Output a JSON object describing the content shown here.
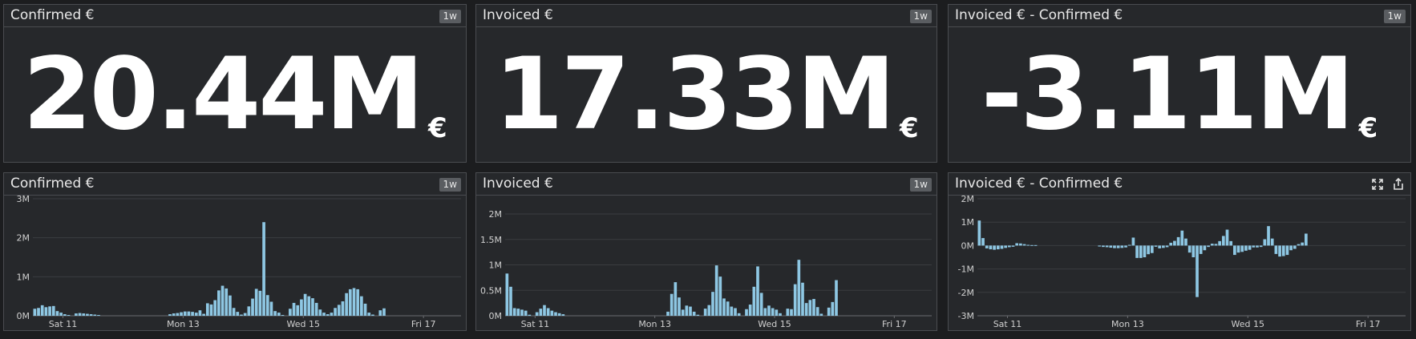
{
  "theme": {
    "bar_color": "#8ec7e3",
    "grid_color": "#3a3c40",
    "panel_bg": "#26282b"
  },
  "query_values": [
    {
      "title": "Confirmed €",
      "badge": "1w",
      "value": "20.44M",
      "unit": "€"
    },
    {
      "title": "Invoiced €",
      "badge": "1w",
      "value": "17.33M",
      "unit": "€"
    },
    {
      "title": "Invoiced € - Confirmed €",
      "badge": "1w",
      "value": "-3.11M",
      "unit": "€"
    }
  ],
  "timeseries": [
    {
      "title": "Confirmed €",
      "badge": "1w"
    },
    {
      "title": "Invoiced €",
      "badge": "1w"
    },
    {
      "title": "Invoiced € - Confirmed €",
      "icons": [
        "expand-icon",
        "export-icon"
      ]
    }
  ],
  "chart_data": [
    {
      "type": "bar",
      "title": "Confirmed €",
      "x_ticks": [
        "Sat 11",
        "Mon 13",
        "Wed 15",
        "Fri 17"
      ],
      "x_tick_index": [
        8,
        40,
        72,
        104
      ],
      "y_ticks": [
        "0M",
        "1M",
        "2M",
        "3M"
      ],
      "y_tick_values": [
        0,
        1,
        2,
        3
      ],
      "ylim": [
        0,
        3
      ],
      "unit": "M€",
      "values": [
        0.18,
        0.2,
        0.27,
        0.22,
        0.24,
        0.25,
        0.12,
        0.08,
        0.04,
        0.02,
        0.0,
        0.06,
        0.07,
        0.06,
        0.05,
        0.04,
        0.03,
        0.02,
        0.0,
        0.0,
        0.0,
        0.0,
        0.0,
        0.0,
        0.0,
        0.0,
        0.0,
        0.0,
        0.0,
        0.0,
        0.0,
        0.0,
        0.0,
        0.0,
        0.0,
        0.0,
        0.04,
        0.06,
        0.07,
        0.09,
        0.11,
        0.11,
        0.1,
        0.08,
        0.14,
        0.05,
        0.32,
        0.29,
        0.4,
        0.65,
        0.77,
        0.7,
        0.52,
        0.2,
        0.1,
        0.03,
        0.07,
        0.24,
        0.44,
        0.69,
        0.64,
        2.4,
        0.53,
        0.36,
        0.12,
        0.08,
        0.02,
        0.0,
        0.18,
        0.33,
        0.27,
        0.42,
        0.56,
        0.5,
        0.45,
        0.33,
        0.16,
        0.08,
        0.04,
        0.08,
        0.2,
        0.28,
        0.37,
        0.58,
        0.68,
        0.71,
        0.68,
        0.5,
        0.31,
        0.08,
        0.03,
        0.0,
        0.14,
        0.19
      ]
    },
    {
      "type": "bar",
      "title": "Invoiced €",
      "x_ticks": [
        "Sat 11",
        "Mon 13",
        "Wed 15",
        "Fri 17"
      ],
      "x_tick_index": [
        8,
        40,
        72,
        104
      ],
      "y_ticks": [
        "0M",
        "0.5M",
        "1M",
        "1.5M",
        "2M"
      ],
      "y_tick_values": [
        0,
        0.5,
        1,
        1.5,
        2
      ],
      "ylim": [
        0,
        2.3
      ],
      "unit": "M€",
      "values": [
        0.83,
        0.57,
        0.15,
        0.14,
        0.12,
        0.1,
        0.02,
        0.0,
        0.07,
        0.14,
        0.21,
        0.15,
        0.1,
        0.07,
        0.05,
        0.03,
        0.0,
        0.0,
        0.0,
        0.0,
        0.0,
        0.0,
        0.0,
        0.0,
        0.0,
        0.0,
        0.0,
        0.0,
        0.0,
        0.0,
        0.0,
        0.0,
        0.0,
        0.0,
        0.0,
        0.0,
        0.0,
        0.0,
        0.0,
        0.0,
        0.0,
        0.0,
        0.0,
        0.08,
        0.43,
        0.66,
        0.36,
        0.12,
        0.2,
        0.18,
        0.08,
        0.02,
        0.0,
        0.14,
        0.21,
        0.47,
        0.99,
        0.77,
        0.34,
        0.28,
        0.18,
        0.15,
        0.05,
        0.0,
        0.13,
        0.22,
        0.57,
        0.97,
        0.45,
        0.15,
        0.2,
        0.15,
        0.12,
        0.05,
        0.0,
        0.14,
        0.13,
        0.62,
        1.1,
        0.65,
        0.25,
        0.31,
        0.33,
        0.17,
        0.04,
        0.0,
        0.16,
        0.27,
        0.7
      ]
    },
    {
      "type": "bar",
      "title": "Invoiced € - Confirmed €",
      "x_ticks": [
        "Sat 11",
        "Mon 13",
        "Wed 15",
        "Fri 17"
      ],
      "x_tick_index": [
        8,
        40,
        72,
        104
      ],
      "y_ticks": [
        "-3M",
        "-2M",
        "-1M",
        "0M",
        "1M",
        "2M"
      ],
      "y_tick_values": [
        -3,
        -2,
        -1,
        0,
        1,
        2
      ],
      "ylim": [
        -3,
        2
      ],
      "unit": "M€",
      "values": [
        1.07,
        0.32,
        -0.12,
        -0.16,
        -0.18,
        -0.16,
        -0.14,
        -0.1,
        -0.07,
        -0.05,
        0.1,
        0.09,
        0.06,
        0.03,
        0.02,
        0.02,
        0.0,
        0.0,
        0.0,
        0.0,
        0.0,
        0.0,
        0.0,
        0.0,
        0.0,
        0.0,
        0.0,
        0.0,
        0.0,
        0.0,
        0.0,
        0.0,
        -0.04,
        -0.06,
        -0.07,
        -0.09,
        -0.11,
        -0.11,
        -0.1,
        -0.08,
        0.03,
        0.34,
        -0.53,
        -0.53,
        -0.5,
        -0.37,
        -0.32,
        -0.05,
        -0.12,
        -0.1,
        -0.07,
        0.12,
        0.2,
        0.36,
        0.64,
        0.3,
        -0.3,
        -0.5,
        -2.2,
        -0.36,
        -0.2,
        -0.06,
        0.08,
        0.07,
        0.19,
        0.41,
        0.68,
        0.19,
        -0.4,
        -0.3,
        -0.27,
        -0.22,
        -0.18,
        -0.08,
        -0.08,
        -0.06,
        0.27,
        0.83,
        0.3,
        -0.36,
        -0.47,
        -0.45,
        -0.4,
        -0.2,
        -0.14,
        0.06,
        0.13,
        0.51
      ]
    }
  ]
}
